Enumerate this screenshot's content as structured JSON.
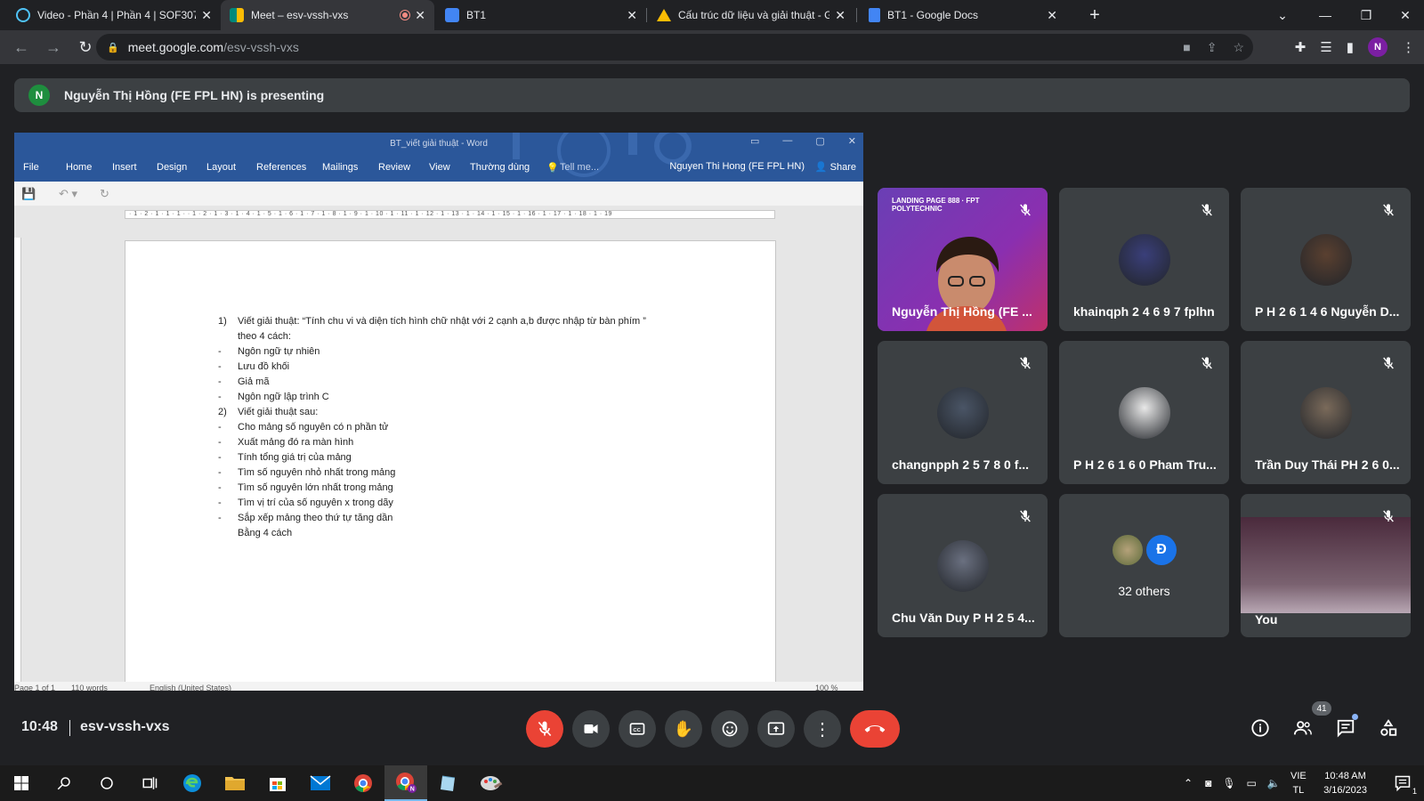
{
  "browser": {
    "tabs": [
      {
        "title": "Video - Phần 4 | Phần 4 | SOF307",
        "icon": "circle-outline-icon",
        "color": "#4fc3f7"
      },
      {
        "title": "Meet – esv-vssh-vxs",
        "icon": "google-meet-icon",
        "color": "#00897b"
      },
      {
        "title": "BT1",
        "icon": "google-classroom-icon",
        "color": "#4285f4"
      },
      {
        "title": "Cấu trúc dữ liệu và giải thuật - G",
        "icon": "google-drive-icon",
        "color": "#fbbc04"
      },
      {
        "title": "BT1 - Google Docs",
        "icon": "google-docs-icon",
        "color": "#4285f4"
      }
    ],
    "url_host": "meet.google.com",
    "url_path": "/esv-vssh-vxs",
    "profile_initial": "N"
  },
  "banner": {
    "avatar_initial": "N",
    "text": "Nguyễn Thị Hồng (FE FPL HN) is presenting"
  },
  "word": {
    "title": "BT_viết giải thuật - Word",
    "ribbon_tabs": [
      "File",
      "Home",
      "Insert",
      "Design",
      "Layout",
      "References",
      "Mailings",
      "Review",
      "View",
      "Thường dùng"
    ],
    "tell_me": "Tell me...",
    "user": "Nguyen Thi Hong (FE FPL HN)",
    "share": "Share",
    "ruler": "· 1 · 2 · 1 · 1 · 1 · · 1 · 2 · 1 · 3 · 1 · 4 · 1 · 5 · 1 · 6 · 1 · 7 · 1 · 8 · 1 · 9 · 1 · 10 · 1 · 11 · 1 · 12 · 1 · 13 · 1 · 14 · 1 · 15 · 1 · 16 · 1 · 17 · 1 · 18 · 1 · 19",
    "status": {
      "page": "Page 1 of 1",
      "words": "110 words",
      "language": "English (United States)",
      "zoom": "100 %"
    },
    "lines": [
      {
        "marker": "1)",
        "text": "Viết giải thuật: “Tính chu vi và diện tích hình chữ nhật với 2 cạnh a,b được nhập từ bàn phím ”"
      },
      {
        "marker": "",
        "text": "theo 4 cách:"
      },
      {
        "marker": "-",
        "text": "Ngôn ngữ tự nhiên"
      },
      {
        "marker": "-",
        "text": "Lưu đồ khối"
      },
      {
        "marker": "-",
        "text": "Giả mã"
      },
      {
        "marker": "-",
        "text": "Ngôn ngữ lập trình C"
      },
      {
        "marker": "2)",
        "text": "Viết giải thuật sau:"
      },
      {
        "marker": "-",
        "text": "Cho mảng số nguyên có n phần tử"
      },
      {
        "marker": "-",
        "text": "Xuất mảng đó ra màn hình"
      },
      {
        "marker": "-",
        "text": "Tính tổng giá trị của mảng"
      },
      {
        "marker": "-",
        "text": "Tìm số nguyên nhỏ nhất trong mảng"
      },
      {
        "marker": "-",
        "text": "Tìm số nguyên lớn nhất trong mảng"
      },
      {
        "marker": "-",
        "text": "Tìm vị trí của số nguyên x trong dãy"
      },
      {
        "marker": "-",
        "text": "Sắp xếp mảng theo thứ tự tăng dần"
      },
      {
        "marker": "",
        "text": "Bằng 4 cách"
      }
    ]
  },
  "participants": [
    {
      "name": "Nguyễn Thị Hồng (FE ...",
      "muted": true,
      "kind": "video",
      "color": "#6a3fb5",
      "logo_text": "LANDING PAGE 888 · FPT POLYTECHNIC"
    },
    {
      "name": "khainqph 2 4 6 9 7 fplhn",
      "muted": true,
      "kind": "avatar",
      "color": "#3a3f7a"
    },
    {
      "name": "P H 2 6 1 4 6 Nguyễn D...",
      "muted": true,
      "kind": "avatar",
      "color": "#5a4030"
    },
    {
      "name": "changnpph 2 5 7 8 0 f...",
      "muted": true,
      "kind": "avatar",
      "color": "#4a5566"
    },
    {
      "name": "P H 2 6 1 6 0 Pham Tru...",
      "muted": true,
      "kind": "avatar",
      "color": "#e8e8e8"
    },
    {
      "name": "Trần Duy Thái PH 2 6 0...",
      "muted": true,
      "kind": "avatar",
      "color": "#7a6a5a"
    },
    {
      "name": "Chu Văn Duy P H 2 5 4...",
      "muted": true,
      "kind": "avatar",
      "color": "#6a7080"
    },
    {
      "name": "32 others",
      "muted": false,
      "kind": "others",
      "color": "#1a73e8",
      "other_initial": "Đ"
    },
    {
      "name": "You",
      "muted": true,
      "kind": "self",
      "color": "#4a2a3c"
    }
  ],
  "meeting": {
    "time": "10:48",
    "code": "esv-vssh-vxs",
    "people_count": "41"
  },
  "taskbar": {
    "lang_top": "VIE",
    "lang_bottom": "TL",
    "clock_time": "10:48 AM",
    "clock_date": "3/16/2023",
    "notif_count": "1"
  }
}
